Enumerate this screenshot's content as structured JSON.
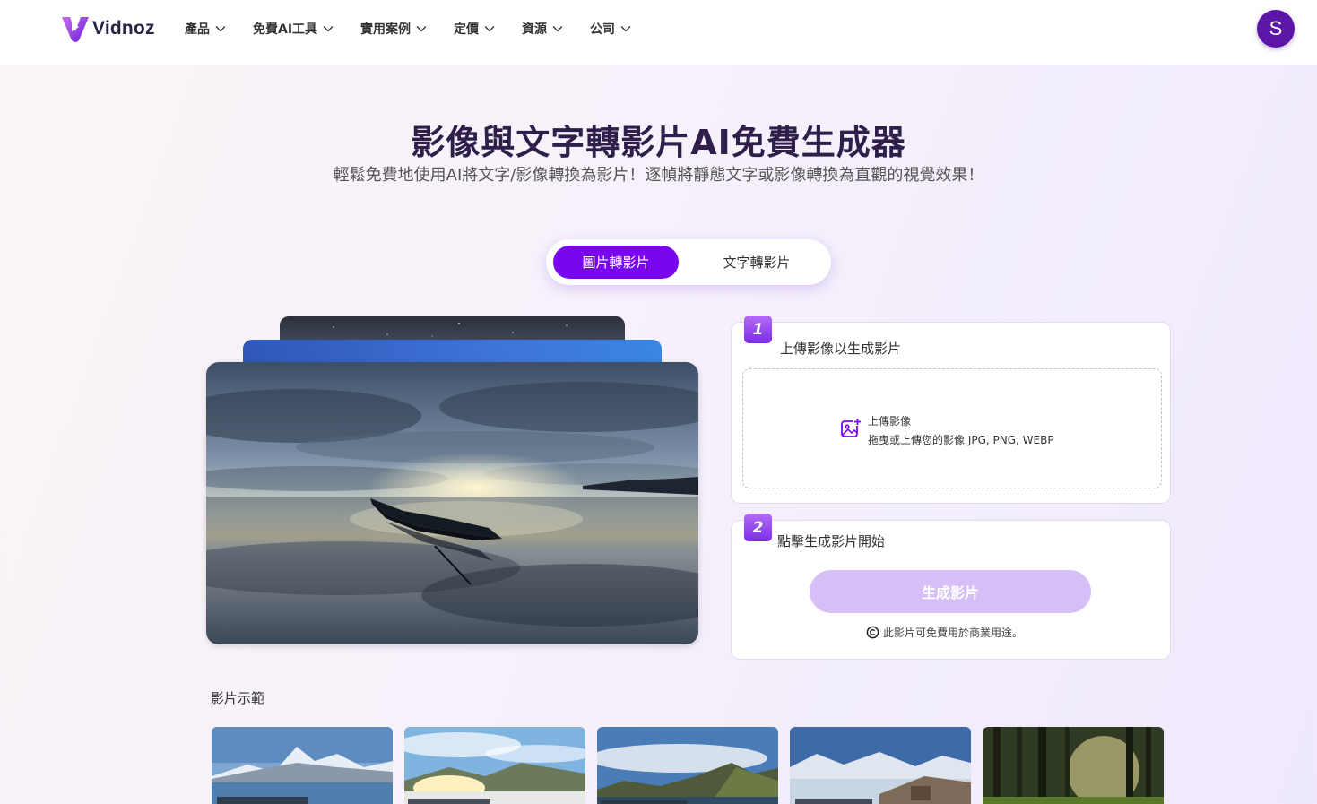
{
  "nav": {
    "brand": "Vidnoz",
    "items": [
      {
        "label": "產品"
      },
      {
        "label": "免費AI工具"
      },
      {
        "label": "實用案例"
      },
      {
        "label": "定價"
      },
      {
        "label": "資源"
      },
      {
        "label": "公司"
      }
    ],
    "avatar_initial": "S"
  },
  "hero": {
    "title": "影像與文字轉影片AI免費生成器",
    "subtitle": "輕鬆免費地使用AI將文字/影像轉換為影片！逐幀將靜態文字或影像轉換為直觀的視覺效果！"
  },
  "mode_toggle": {
    "active": "圖片轉影片",
    "inactive": "文字轉影片"
  },
  "step1": {
    "number": "1",
    "label": "上傳影像以生成影片",
    "upload_title": "上傳影像",
    "upload_hint": "拖曳或上傳您的影像 JPG, PNG, WEBP"
  },
  "step2": {
    "number": "2",
    "label": "點擊生成影片開始",
    "button": "生成影片",
    "license": "此影片可免費用於商業用途。"
  },
  "examples": {
    "label": "影片示範",
    "count": 5
  },
  "colors": {
    "accent": "#7a06f0",
    "button_disabled": "#d6bff7",
    "title": "#2d1f4a",
    "avatar": "#5b16a8"
  }
}
